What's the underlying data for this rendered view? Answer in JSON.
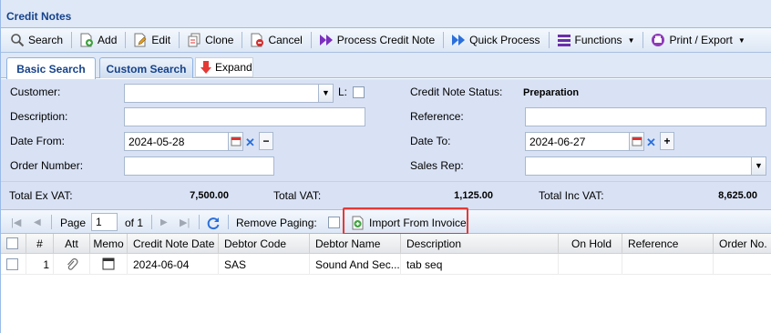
{
  "window": {
    "title": "Credit Notes"
  },
  "toolbar": {
    "search": "Search",
    "add": "Add",
    "edit": "Edit",
    "clone": "Clone",
    "cancel": "Cancel",
    "process_credit_note": "Process Credit Note",
    "quick_process": "Quick Process",
    "functions": "Functions",
    "print_export": "Print / Export"
  },
  "tabs": {
    "basic": "Basic Search",
    "custom": "Custom Search",
    "expand": "Expand"
  },
  "form": {
    "customer_label": "Customer:",
    "customer_value": "",
    "l_label": "L:",
    "status_label": "Credit Note Status:",
    "status_value": "Preparation",
    "description_label": "Description:",
    "description_value": "",
    "reference_label": "Reference:",
    "reference_value": "",
    "date_from_label": "Date From:",
    "date_from_value": "2024-05-28",
    "date_to_label": "Date To:",
    "date_to_value": "2024-06-27",
    "order_number_label": "Order Number:",
    "order_number_value": "",
    "sales_rep_label": "Sales Rep:",
    "sales_rep_value": ""
  },
  "totals": {
    "ex_vat_label": "Total Ex VAT:",
    "ex_vat_value": "7,500.00",
    "vat_label": "Total VAT:",
    "vat_value": "1,125.00",
    "inc_vat_label": "Total Inc VAT:",
    "inc_vat_value": "8,625.00"
  },
  "pager": {
    "page_label": "Page",
    "page_value": "1",
    "of_label": "of 1",
    "remove_paging_label": "Remove Paging:",
    "import_label": "Import From Invoice"
  },
  "grid": {
    "columns": [
      "#",
      "Att",
      "Memo",
      "Credit Note Date",
      "Debtor Code",
      "Debtor Name",
      "Description",
      "On Hold",
      "Reference",
      "Order No."
    ],
    "rows": [
      {
        "num": "1",
        "date": "2024-06-04",
        "debtor_code": "SAS",
        "debtor_name": "Sound And Sec...",
        "description": "tab seq",
        "on_hold": "",
        "reference": "",
        "order_no": ""
      }
    ]
  },
  "colors": {
    "accent": "#15428b",
    "panel_bg": "#d9e2f5",
    "highlight": "#e53935",
    "process_icon": "#7b2fbe",
    "quick_icon": "#2a6fdb"
  }
}
